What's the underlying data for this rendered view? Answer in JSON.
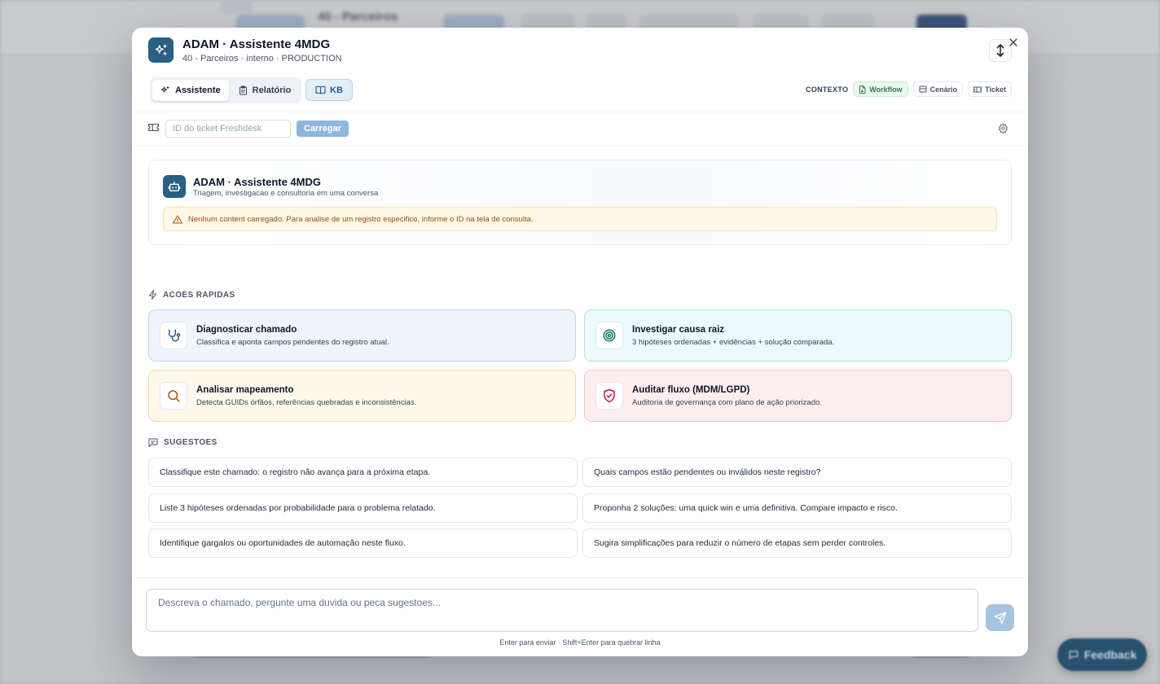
{
  "background": {
    "title": "40 - Parceiros",
    "feedback_label": "Feedback"
  },
  "header": {
    "title": "ADAM · Assistente 4MDG",
    "subtitle": "40 - Parceiros · interno · PRODUCTION",
    "tabs": [
      {
        "label": "Assistente",
        "icon": "sparkles-icon",
        "active": true
      },
      {
        "label": "Relatório",
        "icon": "clipboard-icon",
        "active": false
      }
    ],
    "kb_label": "KB",
    "context": {
      "label": "CONTEXTO",
      "chips": [
        {
          "label": "Workflow",
          "icon": "file-icon",
          "active": true
        },
        {
          "label": "Cenário",
          "icon": "box-icon",
          "active": false
        },
        {
          "label": "Ticket",
          "icon": "ticket-icon",
          "active": false
        }
      ]
    }
  },
  "ticket_bar": {
    "placeholder": "ID do ticket Freshdesk",
    "load_label": "Carregar"
  },
  "welcome": {
    "title": "ADAM · Assistente 4MDG",
    "subtitle": "Triagem, investigacao e consultoria em uma conversa",
    "alert": "Nenhum content carregado. Para analise de um registro especifico, informe o ID na tela de consulta."
  },
  "quick_actions": {
    "label": "ACOES RAPIDAS",
    "items": [
      {
        "title": "Diagnosticar chamado",
        "desc": "Classifica e aponta campos pendentes do registro atual.",
        "icon": "stethoscope-icon",
        "color": "#2d5a8a"
      },
      {
        "title": "Investigar causa raiz",
        "desc": "3 hipóteses ordenadas + evidências + solução comparada.",
        "icon": "target-icon",
        "color": "#0f766e"
      },
      {
        "title": "Analisar mapeamento",
        "desc": "Detecta GUIDs órfãos, referências quebradas e inconsistências.",
        "icon": "search-icon",
        "color": "#b45309"
      },
      {
        "title": "Auditar fluxo (MDM/LGPD)",
        "desc": "Auditoria de governança com plano de ação priorizado.",
        "icon": "shield-check-icon",
        "color": "#be123c"
      }
    ]
  },
  "suggestions": {
    "label": "SUGESTOES",
    "items": [
      "Classifique este chamado: o registro não avança para a próxima etapa.",
      "Quais campos estão pendentes ou inválidos neste registro?",
      "Liste 3 hipóteses ordenadas por probabilidade para o problema relatado.",
      "Proponha 2 soluções: uma quick win e uma definitiva. Compare impacto e risco.",
      "Identifique gargalos ou oportunidades de automação neste fluxo.",
      "Sugira simplificações para reduzir o número de etapas sem perder controles."
    ]
  },
  "composer": {
    "placeholder": "Descreva o chamado, pergunte uma duvida ou peca sugestoes...",
    "hint": "Enter para enviar · Shift+Enter para quebrar linha"
  },
  "colors": {
    "brand": "#2b5f83",
    "send_disabled": "#a7c4df"
  }
}
